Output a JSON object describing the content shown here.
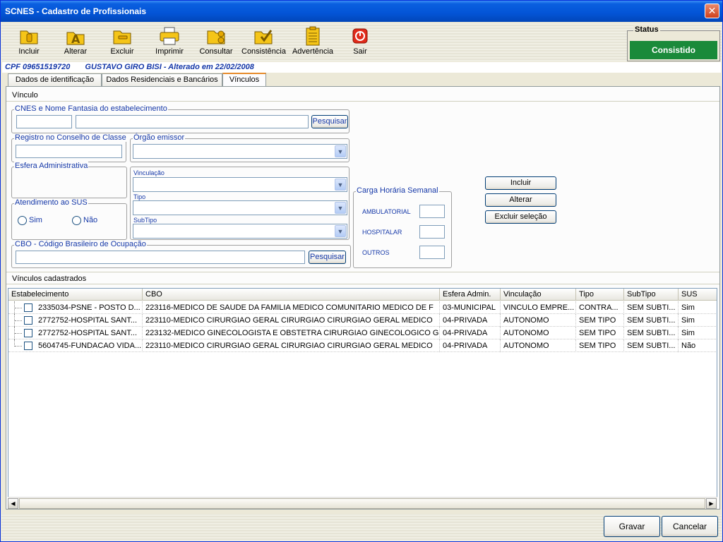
{
  "window": {
    "title": "SCNES - Cadastro de Profissionais",
    "close": "✕"
  },
  "toolbar": {
    "incluir": "Incluir",
    "alterar": "Alterar",
    "excluir": "Excluir",
    "imprimir": "Imprimir",
    "consultar": "Consultar",
    "consistencia": "Consistência",
    "advertencia": "Advertência",
    "sair": "Sair"
  },
  "status": {
    "title": "Status",
    "value": "Consistido",
    "color": "#1a8a3a"
  },
  "info": {
    "cpf": "CPF 09651519720",
    "name": "GUSTAVO GIRO BISI - Alterado em 22/02/2008"
  },
  "tabs": [
    "Dados de identificação",
    "Dados Residenciais e Bancários",
    "Vínculos"
  ],
  "vinculo": {
    "section": "Vínculo",
    "cnes_label": "CNES e Nome Fantasia do estabelecimento",
    "pesquisar": "Pesquisar",
    "registro_label": "Registro no Conselho de Classe",
    "orgao_label": "Órgão emissor",
    "esfera_label": "Esfera Administrativa",
    "vinculacao_label": "Vinculação",
    "tipo_label": "Tipo",
    "subtipo_label": "SubTipo",
    "sus_label": "Atendimento ao SUS",
    "sim": "Sim",
    "nao": "Não",
    "cbo_label": "CBO - Código Brasileiro de Ocupação",
    "cbo_pesquisar": "Pesquisar",
    "carga_label": "Carga Horária Semanal",
    "ambulatorial": "AMBULATORIAL",
    "hospitalar": "HOSPITALAR",
    "outros": "OUTROS",
    "btn_incluir": "Incluir",
    "btn_alterar": "Alterar",
    "btn_excluir": "Excluir seleção"
  },
  "cadastrados": {
    "section": "Vínculos cadastrados",
    "columns": [
      "Estabelecimento",
      "CBO",
      "Esfera Admin.",
      "Vinculação",
      "Tipo",
      "SubTipo",
      "SUS"
    ],
    "rows": [
      [
        "2335034-PSNE - POSTO D...",
        "223116-MEDICO DE SAUDE DA FAMILIA  MEDICO COMUNITARIO MEDICO DE F",
        "03-MUNICIPAL",
        "VINCULO EMPRE...",
        "CONTRA...",
        "SEM SUBTI...",
        "Sim"
      ],
      [
        "2772752-HOSPITAL SANT...",
        "223110-MEDICO CIRURGIAO GERAL  CIRURGIAO CIRURGIAO GERAL MEDICO",
        "04-PRIVADA",
        "AUTONOMO",
        "SEM TIPO",
        "SEM SUBTI...",
        "Sim"
      ],
      [
        "2772752-HOSPITAL SANT...",
        "223132-MEDICO GINECOLOGISTA E OBSTETRA  CIRURGIAO GINECOLOGICO GI",
        "04-PRIVADA",
        "AUTONOMO",
        "SEM TIPO",
        "SEM SUBTI...",
        "Sim"
      ],
      [
        "5604745-FUNDACAO VIDA...",
        "223110-MEDICO CIRURGIAO GERAL  CIRURGIAO CIRURGIAO GERAL MEDICO",
        "04-PRIVADA",
        "AUTONOMO",
        "SEM TIPO",
        "SEM SUBTI...",
        "Não"
      ]
    ]
  },
  "footer": {
    "gravar": "Gravar",
    "cancelar": "Cancelar"
  }
}
